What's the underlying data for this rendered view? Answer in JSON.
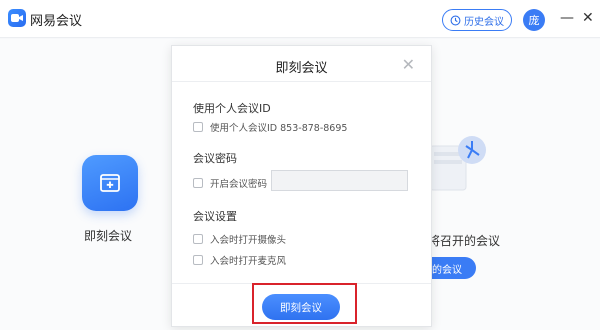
{
  "app": {
    "title": "网易会议",
    "history_label": "历史会议",
    "avatar_text": "庞",
    "minimize_glyph": "—",
    "close_glyph": "✕"
  },
  "home": {
    "instant_meeting_label": "即刻会议",
    "upcoming_label": "即将召开的会议",
    "upcoming_button": "的会议"
  },
  "dialog": {
    "title": "即刻会议",
    "close_glyph": "✕",
    "personal_id_section": "使用个人会议ID",
    "personal_id_option": "使用个人会议ID 853-878-8695",
    "password_section": "会议密码",
    "password_option": "开启会议密码",
    "password_value": "",
    "settings_section": "会议设置",
    "camera_option": "入会时打开摄像头",
    "mic_option": "入会时打开麦克风",
    "start_button": "即刻会议"
  },
  "colors": {
    "accent": "#3a7cf5",
    "highlight": "#d9232b"
  }
}
